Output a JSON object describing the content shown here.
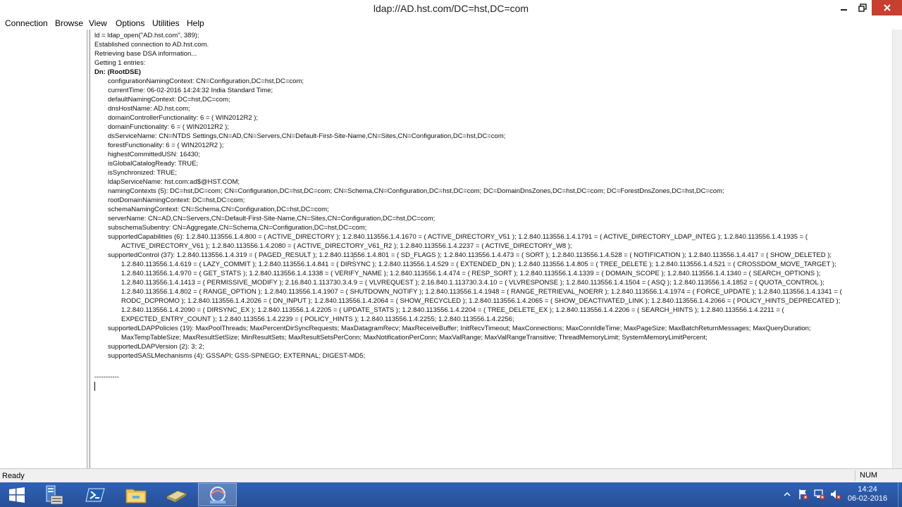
{
  "window": {
    "title": "ldap://AD.hst.com/DC=hst,DC=com"
  },
  "menu": [
    "Connection",
    "Browse",
    "View",
    "Options",
    "Utilities",
    "Help"
  ],
  "output_lines": [
    "ld = ldap_open(\"AD.hst.com\", 389);",
    "Established connection to AD.hst.com.",
    "Retrieving base DSA information...",
    "Getting 1 entries:",
    "Dn: (RootDSE)",
    "configurationNamingContext: CN=Configuration,DC=hst,DC=com;",
    "currentTime: 06-02-2016 14:24:32 India Standard Time;",
    "defaultNamingContext: DC=hst,DC=com;",
    "dnsHostName: AD.hst.com;",
    "domainControllerFunctionality: 6 = ( WIN2012R2 );",
    "domainFunctionality: 6 = ( WIN2012R2 );",
    "dsServiceName: CN=NTDS Settings,CN=AD,CN=Servers,CN=Default-First-Site-Name,CN=Sites,CN=Configuration,DC=hst,DC=com;",
    "forestFunctionality: 6 = ( WIN2012R2 );",
    "highestCommittedUSN: 16430;",
    "isGlobalCatalogReady: TRUE;",
    "isSynchronized: TRUE;",
    "ldapServiceName: hst.com:ad$@HST.COM;",
    "namingContexts (5): DC=hst,DC=com; CN=Configuration,DC=hst,DC=com; CN=Schema,CN=Configuration,DC=hst,DC=com; DC=DomainDnsZones,DC=hst,DC=com; DC=ForestDnsZones,DC=hst,DC=com;",
    "rootDomainNamingContext: DC=hst,DC=com;",
    "schemaNamingContext: CN=Schema,CN=Configuration,DC=hst,DC=com;",
    "serverName: CN=AD,CN=Servers,CN=Default-First-Site-Name,CN=Sites,CN=Configuration,DC=hst,DC=com;",
    "subschemaSubentry: CN=Aggregate,CN=Schema,CN=Configuration,DC=hst,DC=com;",
    "supportedCapabilities (6): 1.2.840.113556.1.4.800 = ( ACTIVE_DIRECTORY ); 1.2.840.113556.1.4.1670 = ( ACTIVE_DIRECTORY_V51 ); 1.2.840.113556.1.4.1791 = ( ACTIVE_DIRECTORY_LDAP_INTEG ); 1.2.840.113556.1.4.1935 = (",
    "ACTIVE_DIRECTORY_V61 ); 1.2.840.113556.1.4.2080 = ( ACTIVE_DIRECTORY_V61_R2 ); 1.2.840.113556.1.4.2237 = ( ACTIVE_DIRECTORY_W8 );",
    "supportedControl (37): 1.2.840.113556.1.4.319 = ( PAGED_RESULT ); 1.2.840.113556.1.4.801 = ( SD_FLAGS ); 1.2.840.113556.1.4.473 = ( SORT ); 1.2.840.113556.1.4.528 = ( NOTIFICATION ); 1.2.840.113556.1.4.417 = ( SHOW_DELETED );",
    "1.2.840.113556.1.4.619 = ( LAZY_COMMIT ); 1.2.840.113556.1.4.841 = ( DIRSYNC ); 1.2.840.113556.1.4.529 = ( EXTENDED_DN ); 1.2.840.113556.1.4.805 = ( TREE_DELETE ); 1.2.840.113556.1.4.521 = ( CROSSDOM_MOVE_TARGET );",
    "1.2.840.113556.1.4.970 = ( GET_STATS ); 1.2.840.113556.1.4.1338 = ( VERIFY_NAME ); 1.2.840.113556.1.4.474 = ( RESP_SORT ); 1.2.840.113556.1.4.1339 = ( DOMAIN_SCOPE ); 1.2.840.113556.1.4.1340 = ( SEARCH_OPTIONS );",
    "1.2.840.113556.1.4.1413 = ( PERMISSIVE_MODIFY ); 2.16.840.1.113730.3.4.9 = ( VLVREQUEST ); 2.16.840.1.113730.3.4.10 = ( VLVRESPONSE ); 1.2.840.113556.1.4.1504 = ( ASQ ); 1.2.840.113556.1.4.1852 = ( QUOTA_CONTROL );",
    "1.2.840.113556.1.4.802 = ( RANGE_OPTION ); 1.2.840.113556.1.4.1907 = ( SHUTDOWN_NOTIFY ); 1.2.840.113556.1.4.1948 = ( RANGE_RETRIEVAL_NOERR ); 1.2.840.113556.1.4.1974 = ( FORCE_UPDATE ); 1.2.840.113556.1.4.1341 = (",
    "RODC_DCPROMO ); 1.2.840.113556.1.4.2026 = ( DN_INPUT ); 1.2.840.113556.1.4.2064 = ( SHOW_RECYCLED ); 1.2.840.113556.1.4.2065 = ( SHOW_DEACTIVATED_LINK ); 1.2.840.113556.1.4.2066 = ( POLICY_HINTS_DEPRECATED );",
    "1.2.840.113556.1.4.2090 = ( DIRSYNC_EX ); 1.2.840.113556.1.4.2205 = ( UPDATE_STATS ); 1.2.840.113556.1.4.2204 = ( TREE_DELETE_EX ); 1.2.840.113556.1.4.2206 = ( SEARCH_HINTS ); 1.2.840.113556.1.4.2211 = (",
    "EXPECTED_ENTRY_COUNT ); 1.2.840.113556.1.4.2239 = ( POLICY_HINTS ); 1.2.840.113556.1.4.2255; 1.2.840.113556.1.4.2256;",
    "supportedLDAPPolicies (19): MaxPoolThreads; MaxPercentDirSyncRequests; MaxDatagramRecv; MaxReceiveBuffer; InitRecvTimeout; MaxConnections; MaxConnIdleTime; MaxPageSize; MaxBatchReturnMessages; MaxQueryDuration;",
    "MaxTempTableSize; MaxResultSetSize; MinResultSets; MaxResultSetsPerConn; MaxNotificationPerConn; MaxValRange; MaxValRangeTransitive; ThreadMemoryLimit; SystemMemoryLimitPercent;",
    "supportedLDAPVersion (2): 3; 2;",
    "supportedSASLMechanisms (4): GSSAPI; GSS-SPNEGO; EXTERNAL; DIGEST-MD5;",
    "-----------"
  ],
  "status": {
    "text": "Ready",
    "num": "NUM"
  },
  "clock": {
    "time": "14:24",
    "date": "06-02-2016"
  },
  "icons": {
    "minimize": "minimize-icon",
    "maximize": "maximize-icon",
    "close": "close-icon",
    "start": "windows-logo-icon",
    "server_manager": "server-manager-icon",
    "powershell": "powershell-icon",
    "explorer": "file-explorer-icon",
    "tool": "admin-tool-icon",
    "ldp": "ldp-icon",
    "tray_chevron": "chevron-up-icon",
    "tray_flag": "action-center-icon",
    "tray_network": "network-icon",
    "tray_volume": "volume-icon"
  },
  "colors": {
    "close_button": "#c7402f",
    "taskbar": "#2b5aa8"
  }
}
